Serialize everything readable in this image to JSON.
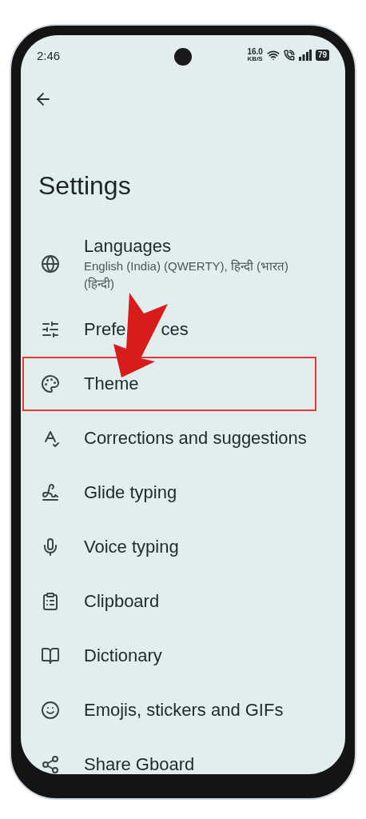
{
  "status_bar": {
    "time": "2:46",
    "speed_value": "16.0",
    "speed_unit": "KB/S",
    "battery": "79"
  },
  "title": "Settings",
  "items": [
    {
      "title": "Languages",
      "subtitle": "English (India) (QWERTY), हिन्दी (भारत) (हिन्दी)",
      "highlighted": false
    },
    {
      "title": "Prefe",
      "title_after": "ces",
      "highlighted": false
    },
    {
      "title": "Theme",
      "highlighted": true
    },
    {
      "title": "Corrections and suggestions",
      "highlighted": false
    },
    {
      "title": "Glide typing",
      "highlighted": false
    },
    {
      "title": "Voice typing",
      "highlighted": false
    },
    {
      "title": "Clipboard",
      "highlighted": false
    },
    {
      "title": "Dictionary",
      "highlighted": false
    },
    {
      "title": "Emojis, stickers and GIFs",
      "highlighted": false
    },
    {
      "title": "Share Gboard",
      "highlighted": false
    }
  ]
}
